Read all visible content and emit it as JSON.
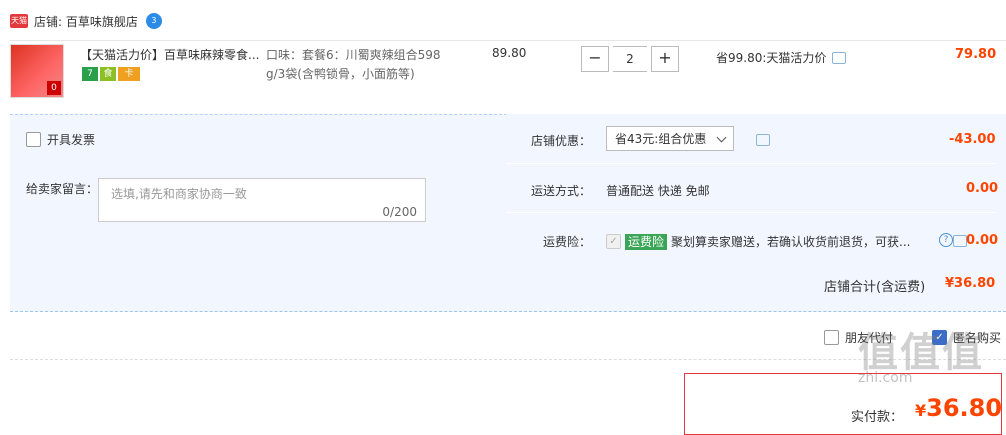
{
  "shop": {
    "label": "店铺: 百草味旗舰店",
    "logo": "天猫",
    "chat_count": "3"
  },
  "item": {
    "title": "【天猫活力价】百草味麻辣零食...",
    "sku_line1": "口味：套餐6：川蜀爽辣组合598",
    "sku_line2": "g/3袋(含鸭锁骨，小面筋等)",
    "unit_price": "89.80",
    "quantity": "2",
    "save_text": "省99.80:天猫活力价",
    "subtotal": "79.80",
    "thumb_badge": "0",
    "service_badges": [
      "7",
      "食",
      "卡"
    ]
  },
  "invoice": {
    "label": "开具发票"
  },
  "memo": {
    "label": "给卖家留言：",
    "placeholder": "选填,请先和商家协商一致",
    "count": "0/200"
  },
  "discount": {
    "label": "店铺优惠：",
    "selected": "省43元:组合优惠",
    "amount": "-43.00"
  },
  "shipping": {
    "label": "运送方式：",
    "value": "普通配送 快递 免邮",
    "amount": "0.00"
  },
  "insurance": {
    "label": "运费险：",
    "badge": "运费险",
    "text": "聚划算卖家赠送，若确认收货前退货，可获...",
    "amount": "0.00"
  },
  "total": {
    "label": "店铺合计(含运费)",
    "value": "¥36.80"
  },
  "options": {
    "friend_pay": "朋友代付",
    "anonymous": "匿名购买"
  },
  "payment": {
    "label": "实付款：",
    "value": "36.80",
    "currency": "¥"
  },
  "watermark": {
    "main": "值值值",
    "sub": "zhi.com"
  }
}
